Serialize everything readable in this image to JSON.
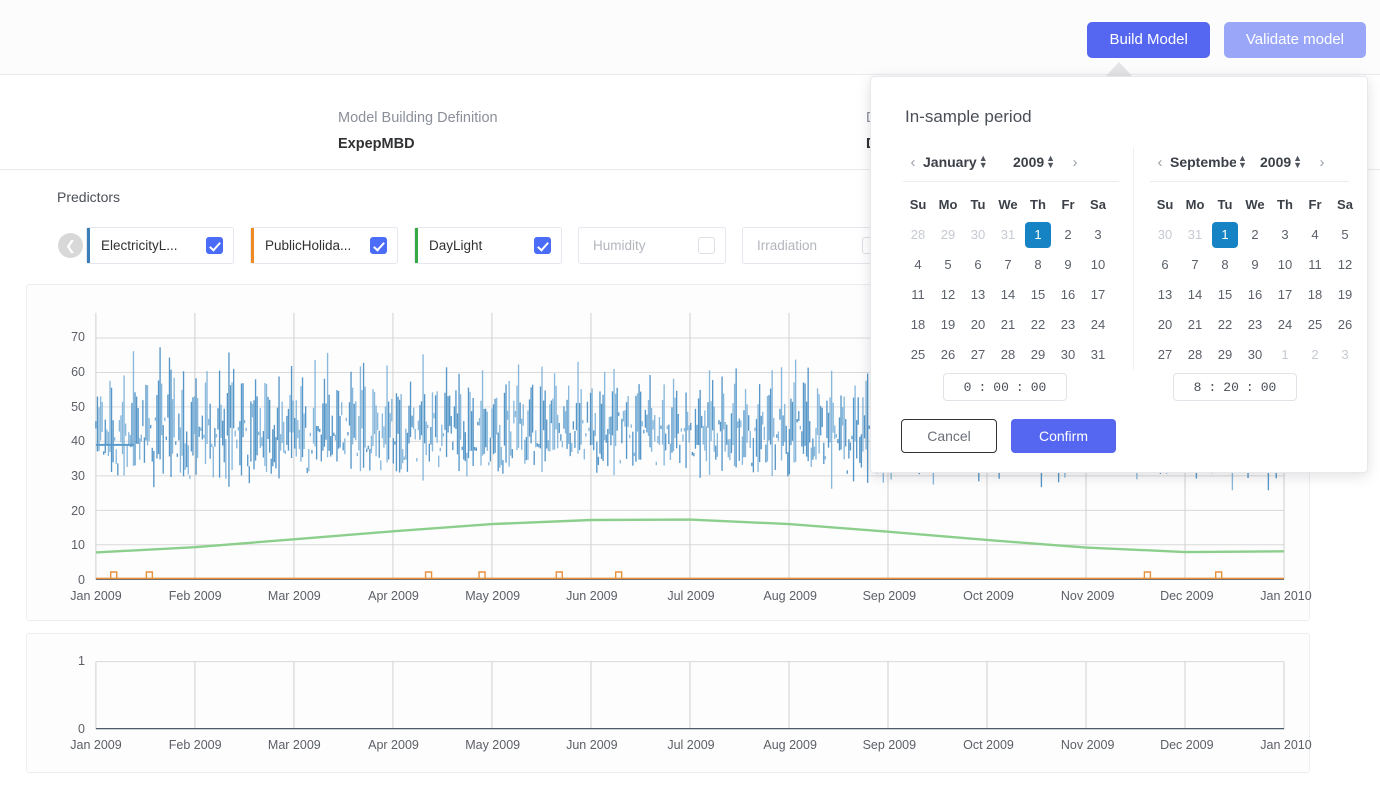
{
  "toolbar": {
    "build_model_label": "Build Model",
    "validate_model_label": "Validate model"
  },
  "definition": {
    "mbd_label": "Model Building Definition",
    "mbd_value": "ExpepMBD",
    "col2_label": "D",
    "col2_value": "D",
    "col3_label": "",
    "col3_value": ""
  },
  "predictors": {
    "title": "Predictors",
    "prev_icon": "chevron-left-icon",
    "items": [
      {
        "label": "ElectricityL...",
        "checked": true,
        "color": "#3c7fb8"
      },
      {
        "label": "PublicHolida...",
        "checked": true,
        "color": "#f08a24"
      },
      {
        "label": "DayLight",
        "checked": true,
        "color": "#36a844"
      },
      {
        "label": "Humidity",
        "checked": false,
        "color": "#ffffff"
      },
      {
        "label": "Irradiation",
        "checked": false,
        "color": "#ffffff"
      }
    ]
  },
  "datepicker": {
    "title": "In-sample period",
    "prev_icon": "chevron-left-icon",
    "next_icon": "chevron-right-icon",
    "spinner_icon": "updown-spinner-icon",
    "left": {
      "month": "January",
      "year": "2009",
      "dow": [
        "Su",
        "Mo",
        "Tu",
        "We",
        "Th",
        "Fr",
        "Sa"
      ],
      "weeks": [
        [
          {
            "d": "28",
            "mute": true
          },
          {
            "d": "29",
            "mute": true
          },
          {
            "d": "30",
            "mute": true
          },
          {
            "d": "31",
            "mute": true
          },
          {
            "d": "1",
            "sel": true
          },
          {
            "d": "2"
          },
          {
            "d": "3"
          }
        ],
        [
          {
            "d": "4"
          },
          {
            "d": "5"
          },
          {
            "d": "6"
          },
          {
            "d": "7"
          },
          {
            "d": "8"
          },
          {
            "d": "9"
          },
          {
            "d": "10"
          }
        ],
        [
          {
            "d": "11"
          },
          {
            "d": "12"
          },
          {
            "d": "13"
          },
          {
            "d": "14"
          },
          {
            "d": "15"
          },
          {
            "d": "16"
          },
          {
            "d": "17"
          }
        ],
        [
          {
            "d": "18"
          },
          {
            "d": "19"
          },
          {
            "d": "20"
          },
          {
            "d": "21"
          },
          {
            "d": "22"
          },
          {
            "d": "23"
          },
          {
            "d": "24"
          }
        ],
        [
          {
            "d": "25"
          },
          {
            "d": "26"
          },
          {
            "d": "27"
          },
          {
            "d": "28"
          },
          {
            "d": "29"
          },
          {
            "d": "30"
          },
          {
            "d": "31"
          }
        ]
      ],
      "time": {
        "h": "0",
        "m": "00",
        "s": "00"
      }
    },
    "right": {
      "month": "September",
      "year": "2009",
      "dow": [
        "Su",
        "Mo",
        "Tu",
        "We",
        "Th",
        "Fr",
        "Sa"
      ],
      "weeks": [
        [
          {
            "d": "30",
            "mute": true
          },
          {
            "d": "31",
            "mute": true
          },
          {
            "d": "1",
            "sel": true
          },
          {
            "d": "2"
          },
          {
            "d": "3"
          },
          {
            "d": "4"
          },
          {
            "d": "5"
          }
        ],
        [
          {
            "d": "6"
          },
          {
            "d": "7"
          },
          {
            "d": "8"
          },
          {
            "d": "9"
          },
          {
            "d": "10"
          },
          {
            "d": "11"
          },
          {
            "d": "12"
          }
        ],
        [
          {
            "d": "13"
          },
          {
            "d": "14"
          },
          {
            "d": "15"
          },
          {
            "d": "16"
          },
          {
            "d": "17"
          },
          {
            "d": "18"
          },
          {
            "d": "19"
          }
        ],
        [
          {
            "d": "20"
          },
          {
            "d": "21"
          },
          {
            "d": "22"
          },
          {
            "d": "23"
          },
          {
            "d": "24"
          },
          {
            "d": "25"
          },
          {
            "d": "26"
          }
        ],
        [
          {
            "d": "27"
          },
          {
            "d": "28"
          },
          {
            "d": "29"
          },
          {
            "d": "30"
          },
          {
            "d": "1",
            "mute": true
          },
          {
            "d": "2",
            "mute": true
          },
          {
            "d": "3",
            "mute": true
          }
        ]
      ],
      "time": {
        "h": "8",
        "m": "20",
        "s": "00"
      }
    },
    "time_sep": ":",
    "cancel_label": "Cancel",
    "confirm_label": "Confirm"
  },
  "chart_data": [
    {
      "type": "line",
      "title": "",
      "xlabel": "",
      "ylabel": "",
      "ylim": [
        0,
        75
      ],
      "yticks": [
        0,
        10,
        20,
        30,
        40,
        50,
        60,
        70
      ],
      "xticks": [
        "Jan 2009",
        "Feb 2009",
        "Mar 2009",
        "Apr 2009",
        "May 2009",
        "Jun 2009",
        "Jul 2009",
        "Aug 2009",
        "Sep 2009",
        "Oct 2009",
        "Nov 2009",
        "Dec 2009",
        "Jan 2010"
      ],
      "grid": true,
      "legend": "none",
      "series": [
        {
          "name": "ElectricityLoad",
          "color": "#3c7fb8",
          "note": "dense high-frequency half-hourly load, band roughly 28-70, mean near 50",
          "envelope_min": [
            39,
            30,
            33,
            34,
            32,
            35,
            33,
            32,
            34,
            33,
            35,
            36,
            34,
            33,
            35,
            36,
            35,
            34,
            36,
            35,
            37,
            36,
            35,
            36,
            37,
            36,
            35,
            36,
            35,
            34,
            36,
            35,
            34,
            33,
            35,
            34,
            33,
            34,
            35,
            36,
            35,
            34,
            35,
            36,
            35,
            34,
            33,
            34,
            35,
            34,
            33,
            34
          ],
          "envelope_max": [
            52,
            62,
            64,
            68,
            65,
            63,
            66,
            64,
            62,
            65,
            63,
            64,
            63,
            62,
            61,
            63,
            62,
            61,
            63,
            62,
            61,
            60,
            62,
            61,
            60,
            59,
            61,
            60,
            59,
            61,
            64,
            62,
            60,
            61,
            63,
            62,
            60,
            61,
            63,
            65,
            63,
            62,
            60,
            59,
            61,
            60,
            58,
            60,
            62,
            61,
            60,
            61
          ]
        },
        {
          "name": "DayLight",
          "color": "#8ccf8c",
          "note": "smooth seasonal curve peaking mid-year",
          "x": [
            "Jan 2009",
            "Feb 2009",
            "Mar 2009",
            "Apr 2009",
            "May 2009",
            "Jun 2009",
            "Jul 2009",
            "Aug 2009",
            "Sep 2009",
            "Oct 2009",
            "Nov 2009",
            "Dec 2009",
            "Jan 2010"
          ],
          "values": [
            7.8,
            9.3,
            11.6,
            13.9,
            16.0,
            17.2,
            17.3,
            16.0,
            13.8,
            11.4,
            9.2,
            7.9,
            8.1
          ]
        },
        {
          "name": "PublicHoliday",
          "color": "#e8913c",
          "note": "sparse unit pulses at holidays along baseline",
          "pulses": [
            "Jan 2009",
            "Jan 2009",
            "Apr 2009",
            "Apr 2009",
            "May 2009",
            "Jun 2009",
            "Dec 2009",
            "Dec 2009"
          ]
        }
      ]
    },
    {
      "type": "line",
      "title": "",
      "xlabel": "",
      "ylabel": "",
      "ylim": [
        0,
        1
      ],
      "yticks": [
        0,
        1
      ],
      "xticks": [
        "Jan 2009",
        "Feb 2009",
        "Mar 2009",
        "Apr 2009",
        "May 2009",
        "Jun 2009",
        "Jul 2009",
        "Aug 2009",
        "Sep 2009",
        "Oct 2009",
        "Nov 2009",
        "Dec 2009",
        "Jan 2010"
      ],
      "grid": true,
      "legend": "none",
      "series": []
    }
  ]
}
